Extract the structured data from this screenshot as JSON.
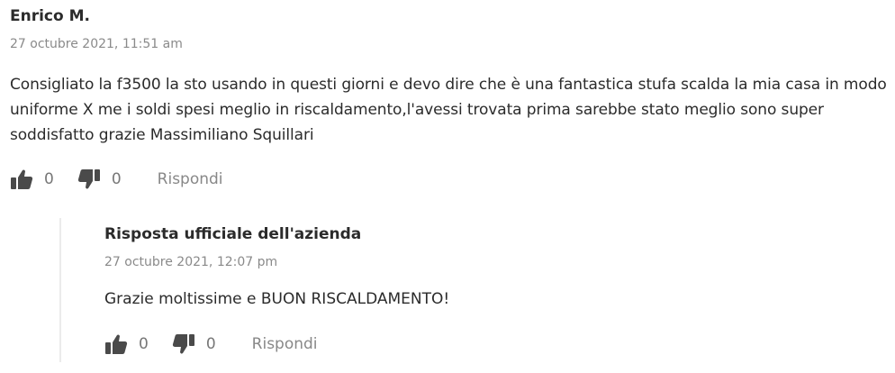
{
  "review": {
    "author": "Enrico M.",
    "date": "27 octubre 2021, 11:51 am",
    "text": "Consigliato la f3500 la sto usando in questi giorni e devo dire che è una fantastica stufa scalda la mia casa in modo uniforme X me i soldi spesi meglio in riscaldamento,l'avessi trovata prima sarebbe stato meglio sono super soddisfatto grazie Massimiliano Squillari",
    "likes": "0",
    "dislikes": "0",
    "reply_label": "Rispondi",
    "like_icon": "thumbs-up-icon",
    "dislike_icon": "thumbs-down-icon"
  },
  "company_reply": {
    "author": "Risposta ufficiale dell'azienda",
    "date": "27 octubre 2021, 12:07 pm",
    "text": "Grazie moltissime e BUON RISCALDAMENTO!",
    "likes": "0",
    "dislikes": "0",
    "reply_label": "Rispondi"
  },
  "colors": {
    "text": "#2b2b2b",
    "muted": "#888888",
    "icon": "#4a4a4a",
    "divider": "#ebebeb"
  }
}
